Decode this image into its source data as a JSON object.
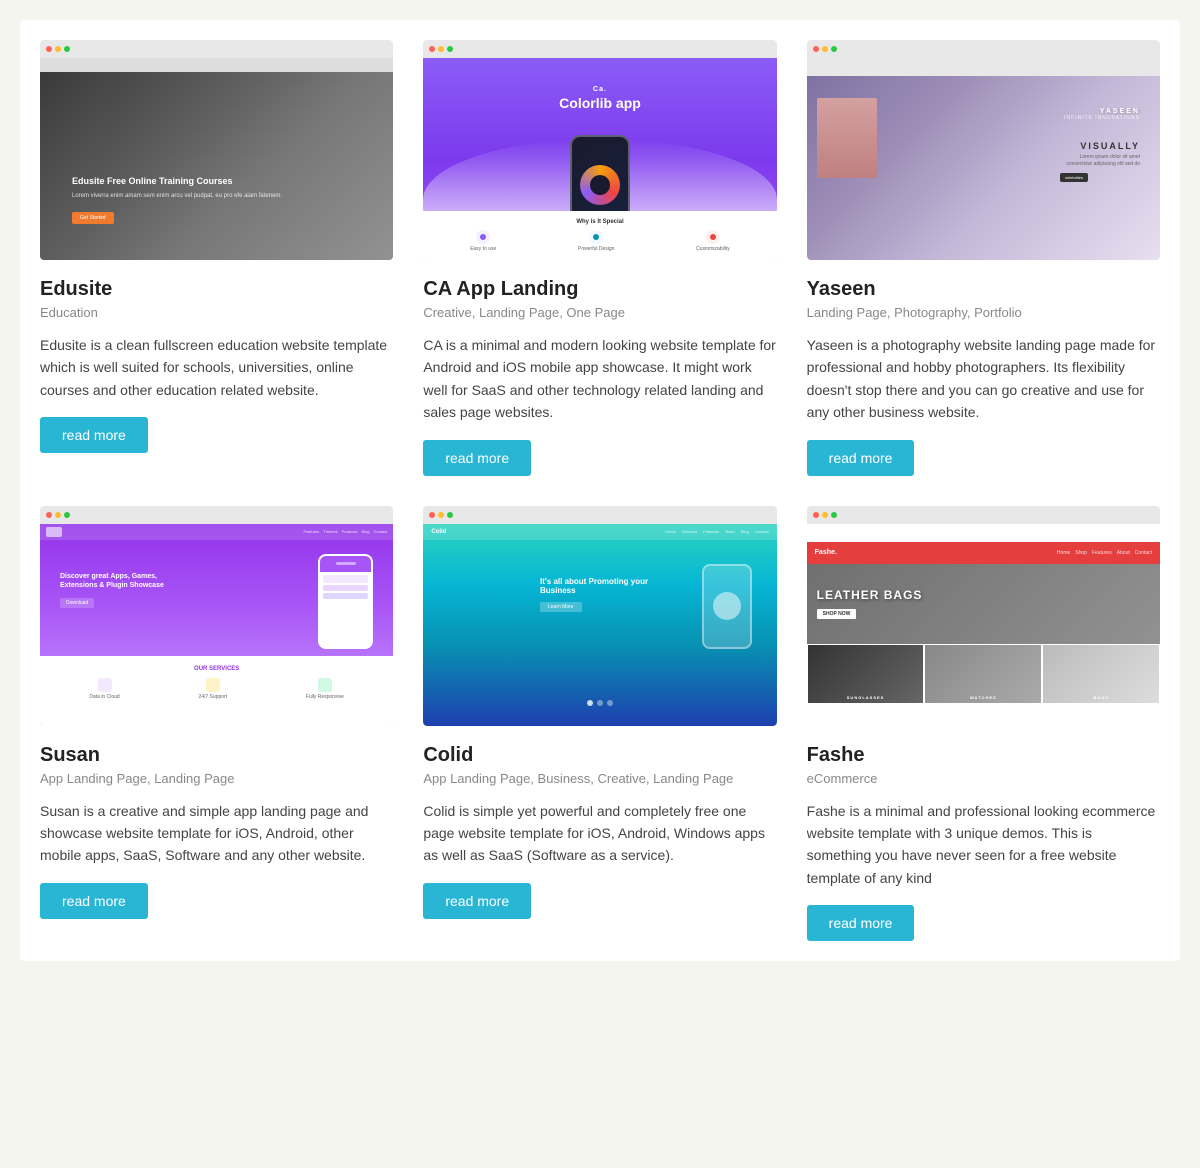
{
  "cards": [
    {
      "id": "edusite",
      "title": "Edusite",
      "tags": "Education",
      "description": "Edusite is a clean fullscreen education website template which is well suited for schools, universities, online courses and other education related website.",
      "btn_label": "read more"
    },
    {
      "id": "ca-app",
      "title": "CA App Landing",
      "tags": "Creative, Landing Page, One Page",
      "description": "CA is a minimal and modern looking website template for Android and iOS mobile app showcase. It might work well for SaaS and other technology related landing and sales page websites.",
      "btn_label": "read more"
    },
    {
      "id": "yaseen",
      "title": "Yaseen",
      "tags": "Landing Page, Photography, Portfolio",
      "description": "Yaseen is a photography website landing page made for professional and hobby photographers. Its flexibility doesn't stop there and you can go creative and use for any other business website.",
      "btn_label": "read more"
    },
    {
      "id": "susan",
      "title": "Susan",
      "tags": "App Landing Page, Landing Page",
      "description": "Susan is a creative and simple app landing page and showcase website template for iOS, Android, other mobile apps, SaaS, Software and any other website.",
      "btn_label": "read more"
    },
    {
      "id": "colid",
      "title": "Colid",
      "tags": "App Landing Page, Business, Creative, Landing Page",
      "description": "Colid is simple yet powerful and completely free one page website template for iOS, Android, Windows apps as well as SaaS (Software as a service).",
      "btn_label": "read more"
    },
    {
      "id": "fashe",
      "title": "Fashe",
      "tags": "eCommerce",
      "description": "Fashe is a minimal and professional looking ecommerce website template with 3 unique demos. This is something you have never seen for a free website template of any kind",
      "btn_label": "read more"
    }
  ],
  "screenshots": {
    "edusite": {
      "headline": "Edusite Free Online Training Courses",
      "body": "Lorem viverra enim amam sem enim arcu vel pudpat, eu pro efe aiam fatenem.",
      "btn": "Get Started"
    },
    "ca": {
      "title": "Colorlib app",
      "subtitle": "Why is It Special",
      "features": [
        "Easy to use",
        "Powerful Design",
        "Customizability"
      ]
    },
    "yaseen": {
      "name": "YASEEN",
      "subtitle": "INFINITE INNOVATIONS",
      "label": "VISUALLY"
    },
    "susan": {
      "headline": "Discover great Apps, Games, Extensions & Plugin Showcase",
      "services_title": "OUR SERVICES",
      "services": [
        "Data in Cloud",
        "24/7 Support",
        "Fully Responsive"
      ]
    },
    "colid": {
      "headline": "It's all about Promoting your Business"
    },
    "fashe": {
      "logo": "Fashe.",
      "nav_items": [
        "Home",
        "Shop",
        "Features",
        "About",
        "Contact"
      ],
      "hero_text": "LEATHER BAGS",
      "products": [
        "SUNGLASSES",
        "WATCHES",
        "BAGS"
      ]
    }
  }
}
